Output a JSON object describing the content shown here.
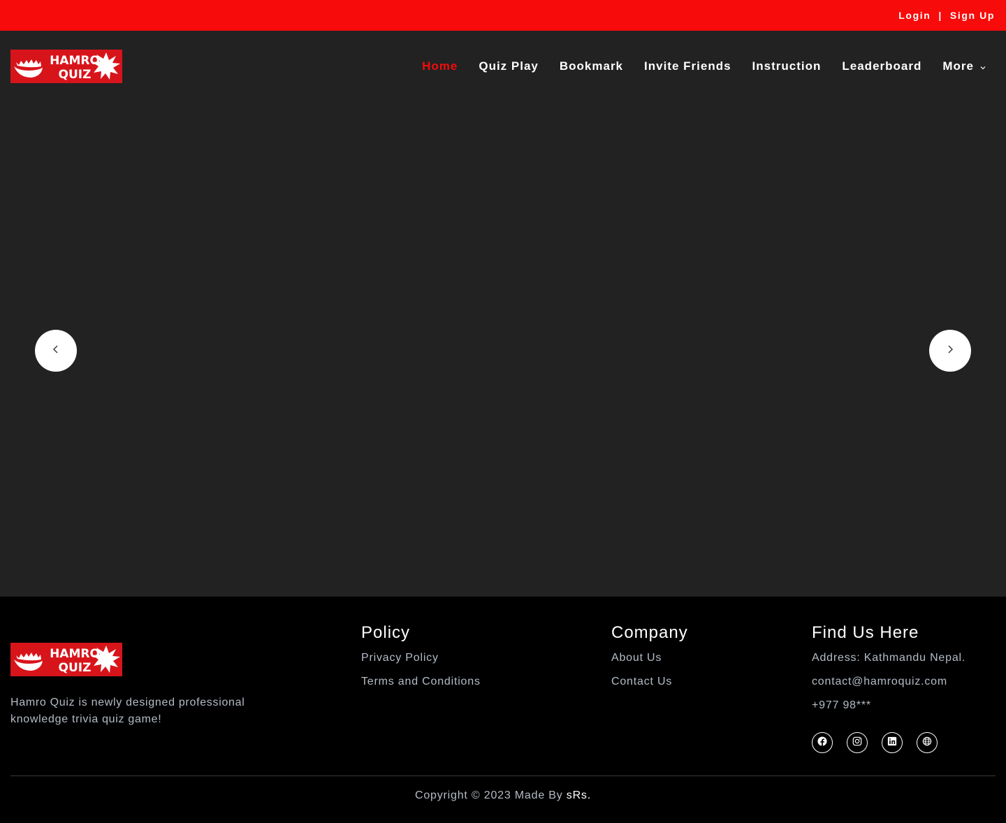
{
  "topbar": {
    "login_label": "Login",
    "separator": "|",
    "signup_label": "Sign Up"
  },
  "logo": {
    "line1": "HAMRO",
    "line2": "QUIZ"
  },
  "nav": {
    "items": [
      {
        "label": "Home",
        "active": true
      },
      {
        "label": "Quiz Play"
      },
      {
        "label": "Bookmark"
      },
      {
        "label": "Invite Friends"
      },
      {
        "label": "Instruction"
      },
      {
        "label": "Leaderboard"
      }
    ],
    "more_label": "More"
  },
  "hero": {
    "prev_icon": "chevron-left-icon",
    "next_icon": "chevron-right-icon"
  },
  "footer": {
    "about_text": "Hamro Quiz is newly designed professional knowledge trivia quiz game!",
    "policy": {
      "title": "Policy",
      "links": [
        "Privacy Policy",
        "Terms and Conditions"
      ]
    },
    "company": {
      "title": "Company",
      "links": [
        "About Us",
        "Contact Us"
      ]
    },
    "find_us": {
      "title": "Find Us Here",
      "address": "Address: Kathmandu Nepal.",
      "email": "contact@hamroquiz.com",
      "phone": "+977 98***"
    },
    "social_icons": [
      "facebook-icon",
      "instagram-icon",
      "linkedin-icon",
      "globe-icon"
    ],
    "copyright_prefix": "Copyright © 2023 Made By ",
    "copyright_brand": "sRs."
  },
  "colors": {
    "topbar_bg": "#f80b0b",
    "page_bg": "#222222",
    "footer_bg": "#000000",
    "accent": "#f40b0b",
    "logo_bg": "#d8141b",
    "muted_text": "#b4bcc6"
  }
}
